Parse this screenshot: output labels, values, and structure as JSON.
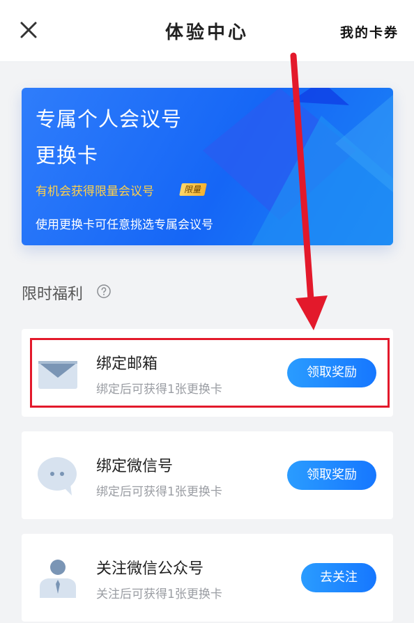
{
  "header": {
    "title": "体验中心",
    "right_link": "我的卡券",
    "close_icon": "close-icon"
  },
  "banner": {
    "line1": "专属个人会议号",
    "line2": "更换卡",
    "subtitle": "有机会获得限量会议号",
    "badge": "限量",
    "description": "使用更换卡可任意挑选专属会议号"
  },
  "section": {
    "title": "限时福利",
    "help_icon": "question-circle-icon"
  },
  "tasks": [
    {
      "title": "绑定邮箱",
      "desc": "绑定后可获得1张更换卡",
      "button": "领取奖励",
      "icon": "envelope-icon"
    },
    {
      "title": "绑定微信号",
      "desc": "绑定后可获得1张更换卡",
      "button": "领取奖励",
      "icon": "chat-bubble-icon"
    },
    {
      "title": "关注微信公众号",
      "desc": "关注后可获得1张更换卡",
      "button": "去关注",
      "icon": "person-icon"
    }
  ],
  "colors": {
    "accent": "#1677ff",
    "banner_blue": "#1566f6",
    "gold": "#ffd04a",
    "annotation_red": "#e3192b"
  }
}
